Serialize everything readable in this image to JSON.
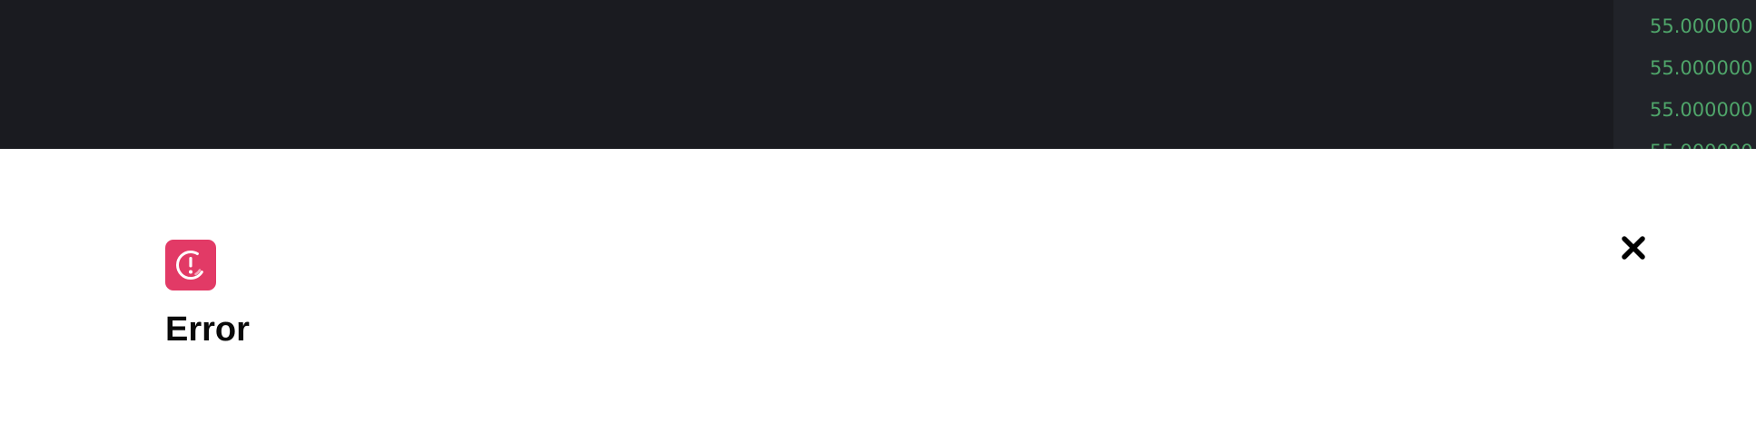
{
  "background": {
    "price_values": [
      "55.000000",
      "55.000000",
      "55.000000",
      "55.000000"
    ],
    "colors": {
      "page": "#1a1b20",
      "side_panel": "#212329",
      "price_text": "#4fa56a"
    }
  },
  "modal": {
    "title": "Error",
    "icon": "alert-circle-icon",
    "close_icon": "close-icon",
    "colors": {
      "background": "#ffffff",
      "icon_background": "#e23a66",
      "title": "#0a0a0a"
    }
  }
}
